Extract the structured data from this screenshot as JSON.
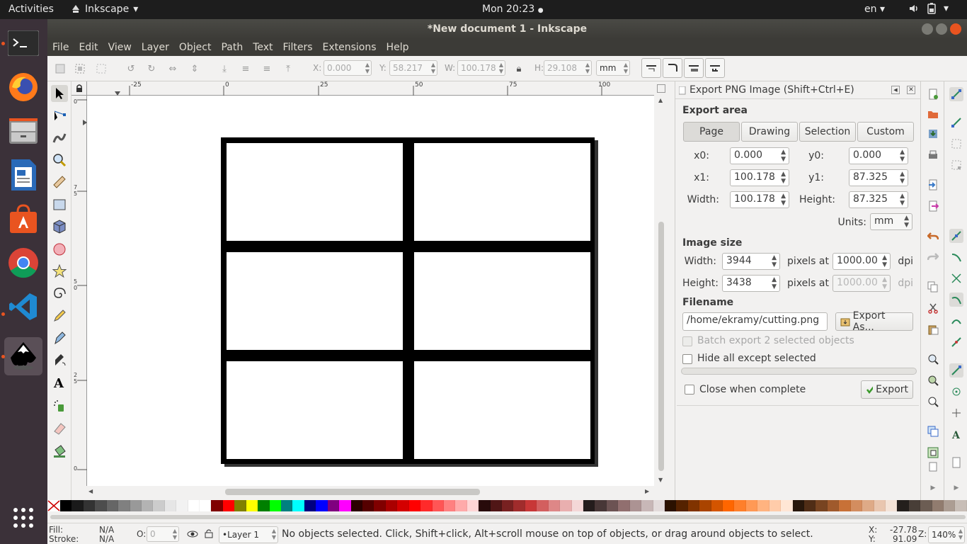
{
  "topbar": {
    "activities": "Activities",
    "app_name": "Inkscape",
    "clock": "Mon 20:23",
    "language": "en"
  },
  "window": {
    "title": "*New document 1 - Inkscape"
  },
  "menu": [
    "File",
    "Edit",
    "View",
    "Layer",
    "Object",
    "Path",
    "Text",
    "Filters",
    "Extensions",
    "Help"
  ],
  "controls": {
    "x_label": "X:",
    "x_value": "0.000",
    "y_label": "Y:",
    "y_value": "58.217",
    "w_label": "W:",
    "w_value": "100.178",
    "h_label": "H:",
    "h_value": "29.108",
    "unit": "mm"
  },
  "ruler": {
    "h_ticks": [
      "-25",
      "0",
      "25",
      "50",
      "75",
      "100"
    ],
    "v_ticks": [
      "0",
      "7",
      "5",
      "5",
      "0",
      "2",
      "5",
      "0"
    ]
  },
  "export_dialog": {
    "title": "Export PNG Image (Shift+Ctrl+E)",
    "export_area_heading": "Export area",
    "tabs": [
      "Page",
      "Drawing",
      "Selection",
      "Custom"
    ],
    "active_tab": "Page",
    "x0_label": "x0:",
    "x0": "0.000",
    "y0_label": "y0:",
    "y0": "0.000",
    "x1_label": "x1:",
    "x1": "100.178",
    "y1_label": "y1:",
    "y1": "87.325",
    "width_label": "Width:",
    "width": "100.178",
    "height_label": "Height:",
    "height": "87.325",
    "units_label": "Units:",
    "units": "mm",
    "image_size_heading": "Image size",
    "img_width_label": "Width:",
    "img_width": "3944",
    "img_height_label": "Height:",
    "img_height": "3438",
    "pixels_at": "pixels at",
    "dpi_x": "1000.00",
    "dpi_y": "1000.00",
    "dpi_label": "dpi",
    "filename_heading": "Filename",
    "filename": "/home/ekramy/cutting.png",
    "export_as_label": "Export As...",
    "batch_export_label": "Batch export 2 selected objects",
    "hide_all_label": "Hide all except selected",
    "close_when_complete_label": "Close when complete",
    "export_label": "Export"
  },
  "status": {
    "fill_label": "Fill:",
    "fill_value": "N/A",
    "stroke_label": "Stroke:",
    "stroke_value": "N/A",
    "opacity_label": "O:",
    "opacity_value": "0",
    "layer": "•Layer 1",
    "message": "No objects selected. Click, Shift+click, Alt+scroll mouse on top of objects, or drag around objects to select.",
    "x_label": "X:",
    "x_value": "-27.78",
    "y_label": "Y:",
    "y_value": "91.09",
    "zoom_label": "Z:",
    "zoom_value": "140%"
  },
  "palette_colors": [
    "#000000",
    "#1a1a1a",
    "#333333",
    "#4d4d4d",
    "#666666",
    "#808080",
    "#999999",
    "#b3b3b3",
    "#cccccc",
    "#e6e6e6",
    "#f2f2f2",
    "#ffffff",
    "#ffffff",
    "#800000",
    "#ff0000",
    "#808000",
    "#ffff00",
    "#008000",
    "#00ff00",
    "#008080",
    "#00ffff",
    "#000080",
    "#0000ff",
    "#800080",
    "#ff00ff",
    "#2b0000",
    "#550000",
    "#800000",
    "#aa0000",
    "#d40000",
    "#ff0000",
    "#ff2a2a",
    "#ff5555",
    "#ff8080",
    "#ffaaaa",
    "#ffd5d5",
    "#280b0b",
    "#501616",
    "#782121",
    "#a02c2c",
    "#c83737",
    "#d35f5f",
    "#de8787",
    "#e9afaf",
    "#f4d7d7",
    "#241c1c",
    "#483737",
    "#6c5353",
    "#916f6f",
    "#ac9393",
    "#c8b7b7",
    "#e3dbdb",
    "#2b1100",
    "#552200",
    "#803300",
    "#aa4400",
    "#d45500",
    "#ff6600",
    "#ff7f2a",
    "#ff9955",
    "#ffb380",
    "#ffccaa",
    "#ffe6d5",
    "#28170b",
    "#502d16",
    "#784421",
    "#a05a2c",
    "#c87137",
    "#d38d5f",
    "#deaa87",
    "#e9c6af",
    "#f4e3d7",
    "#241f1c",
    "#483e37",
    "#6c5d53",
    "#917c6f",
    "#ac9d93",
    "#c8beb7"
  ]
}
